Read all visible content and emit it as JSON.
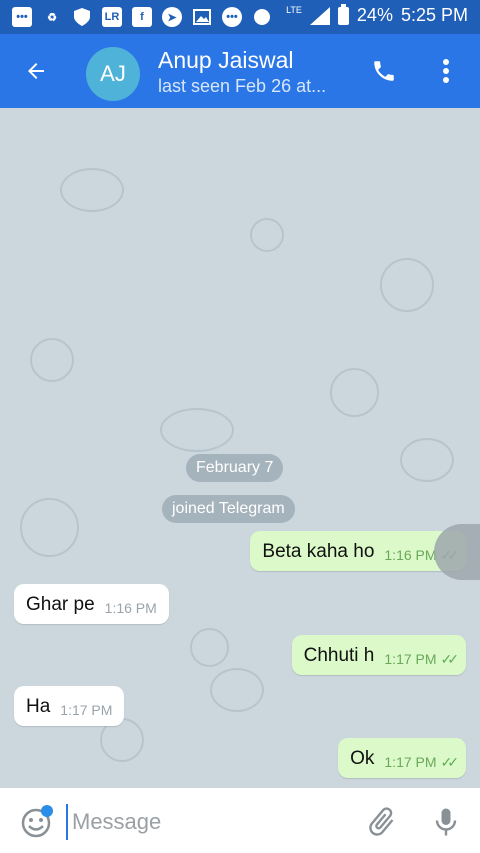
{
  "status_bar": {
    "battery": "24%",
    "time": "5:25 PM",
    "network": "LTE",
    "icons": [
      "more-icon",
      "sync-icon",
      "shield-icon",
      "lr-icon",
      "facebook-icon",
      "send-icon",
      "image-icon",
      "messenger-icon",
      "record-icon"
    ]
  },
  "header": {
    "avatar_initials": "AJ",
    "name": "Anup Jaiswal",
    "status": "last seen Feb 26 at..."
  },
  "chat": {
    "date_label": "February 7",
    "event_label": "joined Telegram",
    "messages": [
      {
        "direction": "out",
        "text": "Beta kaha ho",
        "time": "1:16 PM",
        "ticks": "✓✓"
      },
      {
        "direction": "in",
        "text": "Ghar pe",
        "time": "1:16 PM"
      },
      {
        "direction": "out",
        "text": "Chhuti h",
        "time": "1:17 PM",
        "ticks": "✓✓"
      },
      {
        "direction": "in",
        "text": "Ha",
        "time": "1:17 PM"
      },
      {
        "direction": "out",
        "text": "Ok",
        "time": "1:17 PM",
        "ticks": "✓✓"
      }
    ]
  },
  "input": {
    "placeholder": "Message"
  },
  "colors": {
    "status_bar": "#1f5fb8",
    "app_bar": "#2a76e6",
    "chat_background": "#ccd6dd",
    "outgoing_bubble": "#dcf9c9",
    "incoming_bubble": "#ffffff"
  }
}
